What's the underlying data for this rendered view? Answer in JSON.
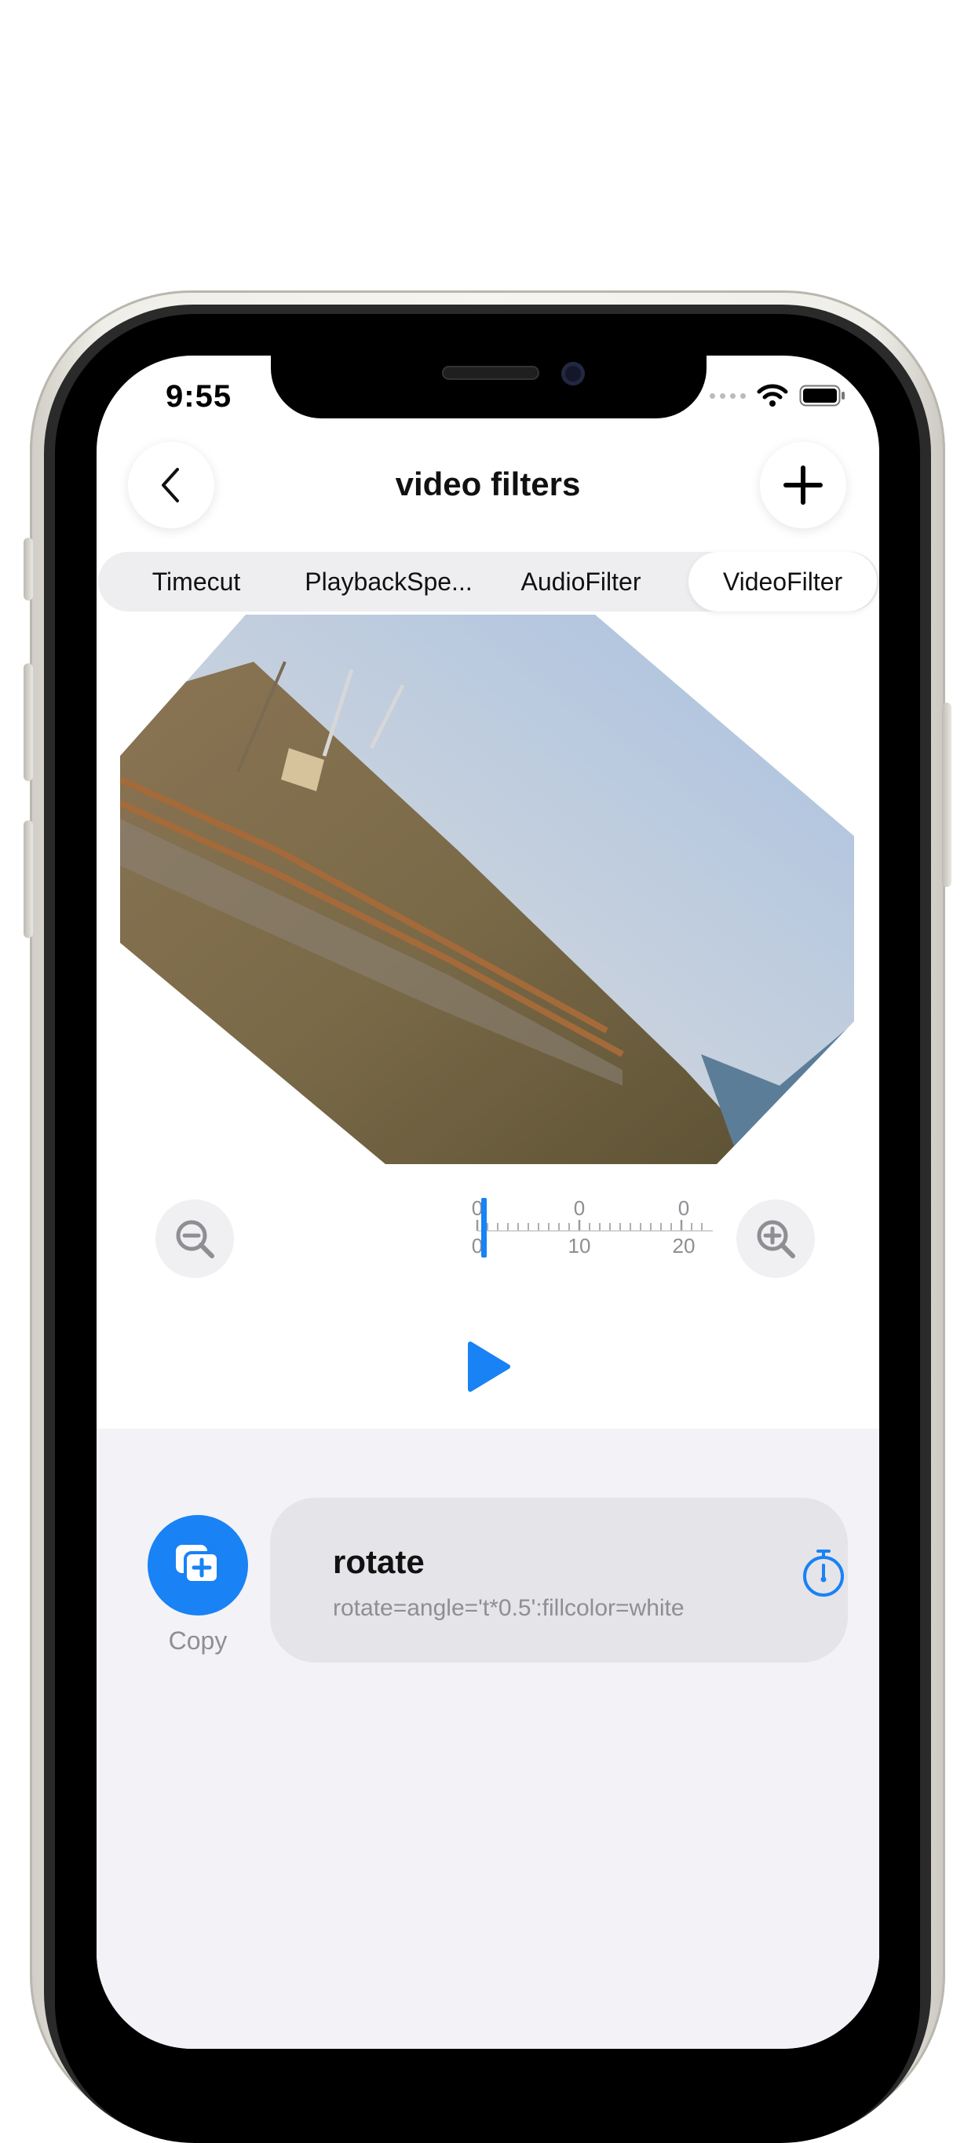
{
  "status_bar": {
    "time": "9:55"
  },
  "nav": {
    "title": "video filters"
  },
  "tabs": [
    {
      "label": "Timecut",
      "active": false
    },
    {
      "label": "PlaybackSpe...",
      "active": false
    },
    {
      "label": "AudioFilter",
      "active": false
    },
    {
      "label": "VideoFilter",
      "active": true
    }
  ],
  "timeline": {
    "top_labels": [
      "0",
      "0",
      "0"
    ],
    "bottom_labels": [
      "0",
      "10",
      "20"
    ],
    "playhead_position": 0
  },
  "bottom_panel": {
    "copy_label": "Copy",
    "filter": {
      "name": "rotate",
      "expression": "rotate=angle='t*0.5':fillcolor=white"
    }
  },
  "colors": {
    "accent": "#1982f4",
    "panel_bg": "#f2f2f7",
    "card_bg": "#e4e4e9"
  },
  "icons": [
    "back-chevron-icon",
    "plus-icon",
    "zoom-out-icon",
    "zoom-in-icon",
    "play-icon",
    "copy-icon",
    "timer-icon",
    "wifi-icon",
    "battery-icon"
  ]
}
